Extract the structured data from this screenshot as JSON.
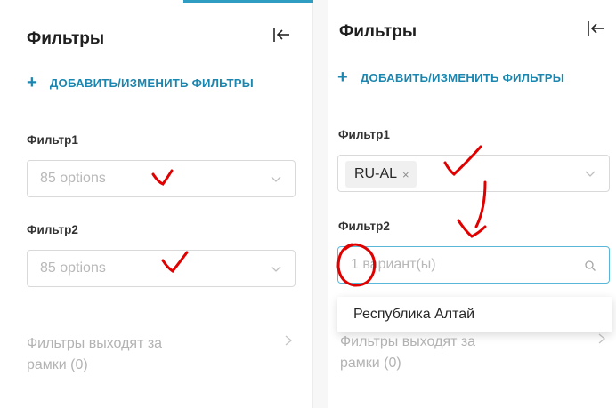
{
  "left_panel": {
    "title": "Фильтры",
    "add_filters": "ДОБАВИТЬ/ИЗМЕНИТЬ ФИЛЬТРЫ",
    "filter1": {
      "label": "Фильтр1",
      "placeholder": "85 options"
    },
    "filter2": {
      "label": "Фильтр2",
      "placeholder": "85 options"
    },
    "out_of_scope": {
      "line1": "Фильтры выходят за",
      "line2": "рамки (0)"
    }
  },
  "right_panel": {
    "title": "Фильтры",
    "add_filters": "ДОБАВИТЬ/ИЗМЕНИТЬ ФИЛЬТРЫ",
    "filter1": {
      "label": "Фильтр1",
      "tag": "RU-AL",
      "tag_remove": "×"
    },
    "filter2": {
      "label": "Фильтр2",
      "placeholder": "1 вариант(ы)"
    },
    "dropdown": {
      "options": [
        "Республика Алтай"
      ]
    },
    "out_of_scope": {
      "line1": "Фильтры выходят за",
      "line2": "рамки (0)"
    }
  },
  "icons": {
    "collapse": "collapse-panel-icon",
    "chevron_down": "chevron-down-icon",
    "chevron_right": "chevron-right-icon",
    "search": "search-icon",
    "plus": "+"
  },
  "colors": {
    "accent": "#1b87b0",
    "annotation": "#e00000",
    "focus_border": "#59b7d9"
  }
}
